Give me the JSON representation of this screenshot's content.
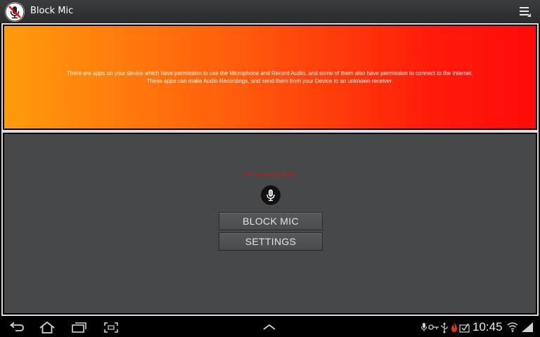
{
  "app": {
    "title": "Block Mic",
    "icon": "mic-blocked-icon"
  },
  "action_bar": {
    "overflow_icon": "overflow-menu-icon"
  },
  "warning": {
    "line1": "There are apps on your device which have permission to use the Microphone and Record Audio, and some of them also have permission to connect to the Internet.",
    "line2": "These apps can make Audio Recordings, and send them from your Device to an unknown receiver.",
    "gradient_start": "#ff9b0c",
    "gradient_end": "#ff0a0a"
  },
  "controls": {
    "status_text": "MIC IS NOT BLOCKED",
    "status_color": "#e01010",
    "mic_icon": "microphone-icon",
    "block_button_label": "BLOCK MIC",
    "settings_button_label": "SETTINGS"
  },
  "system_bar": {
    "time": "10:45",
    "nav_icons": [
      "back-icon",
      "home-icon",
      "recent-apps-icon",
      "screenshot-icon",
      "up-arrow-icon"
    ],
    "status_icons": [
      "mic-status-icon",
      "key-icon",
      "usb-icon",
      "fire-icon",
      "download-icon",
      "wifi-icon",
      "battery-icon"
    ]
  }
}
